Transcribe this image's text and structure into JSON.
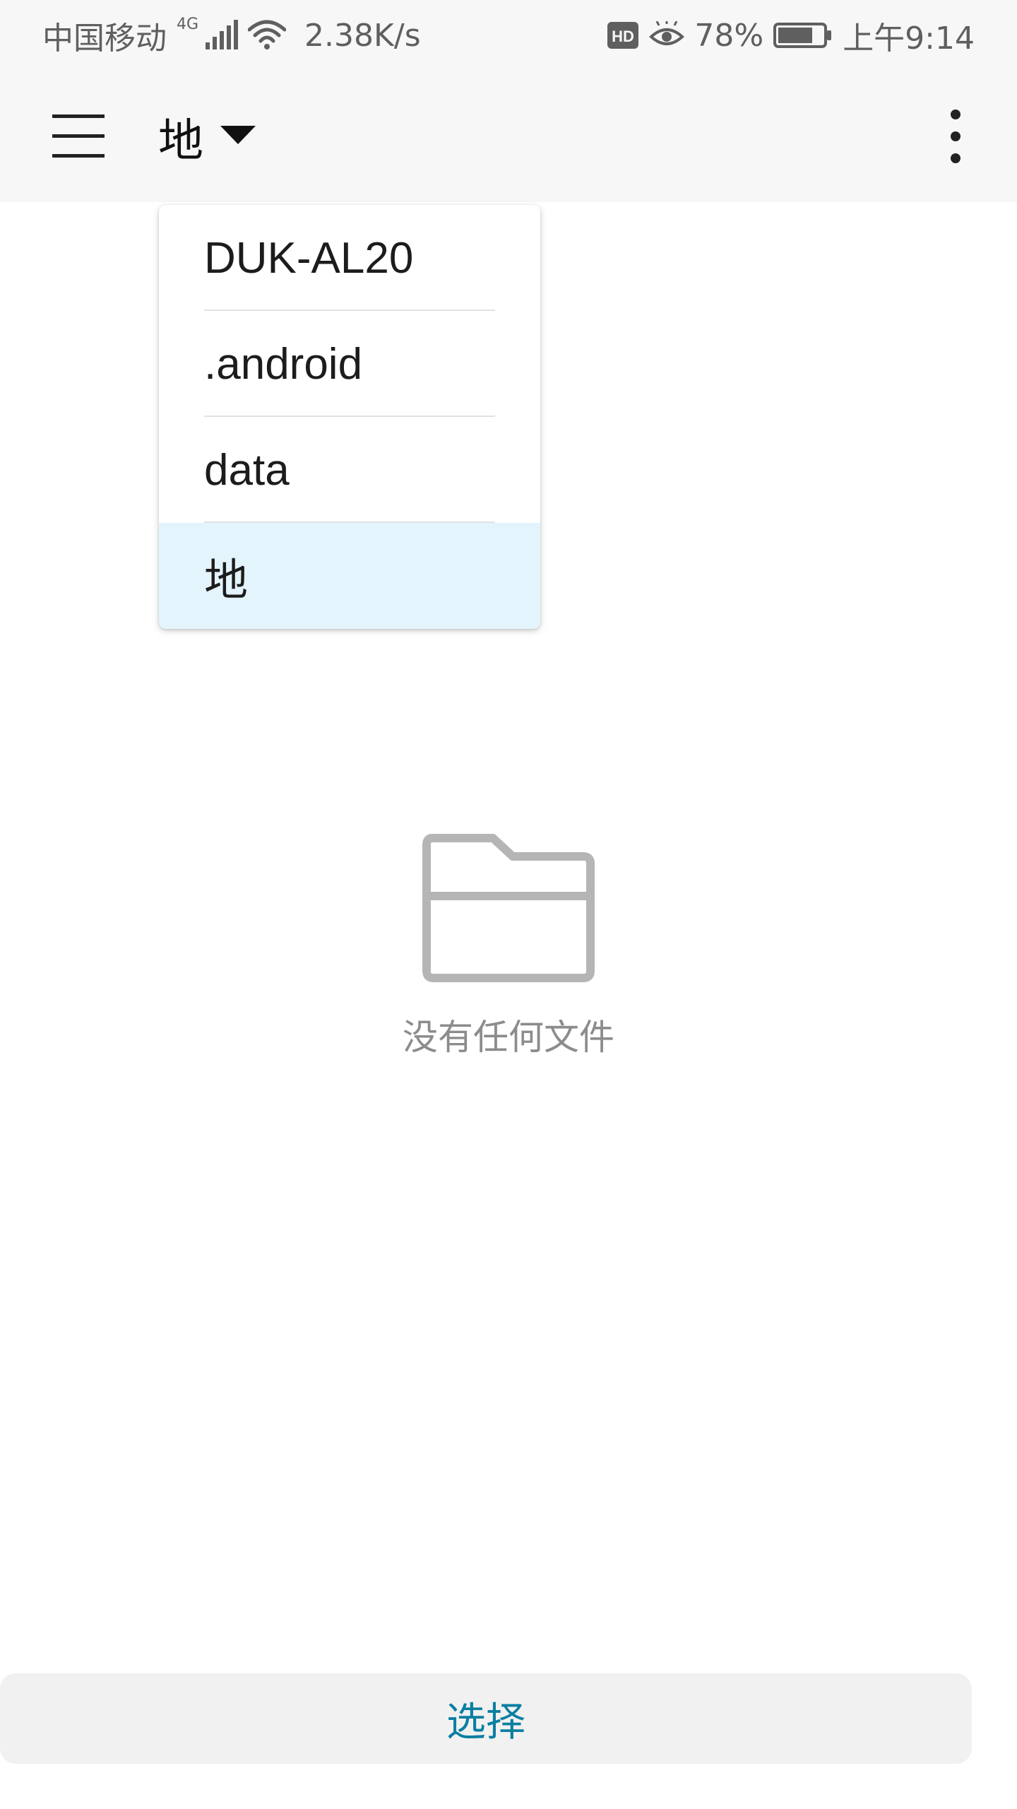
{
  "status_bar": {
    "carrier": "中国移动",
    "network_type": "4G",
    "speed": "2.38K/s",
    "battery_percent": "78%",
    "battery_level": 0.78,
    "time": "上午9:14",
    "icons": [
      "signal-icon",
      "wifi-icon",
      "hd-icon",
      "eye-icon",
      "battery-icon"
    ]
  },
  "app_bar": {
    "menu_icon": "hamburger-menu-icon",
    "current_path": "地",
    "dropdown_icon": "caret-down-icon",
    "overflow_icon": "more-vertical-icon"
  },
  "dropdown": {
    "items": [
      {
        "label": "DUK-AL20",
        "selected": false
      },
      {
        "label": ".android",
        "selected": false
      },
      {
        "label": "data",
        "selected": false
      },
      {
        "label": "地",
        "selected": true
      }
    ],
    "selected_color": "#e4f4fc"
  },
  "empty_state": {
    "icon": "empty-folder-icon",
    "message": "没有任何文件"
  },
  "footer": {
    "select_label": "选择",
    "accent_color": "#0a7fa2"
  }
}
